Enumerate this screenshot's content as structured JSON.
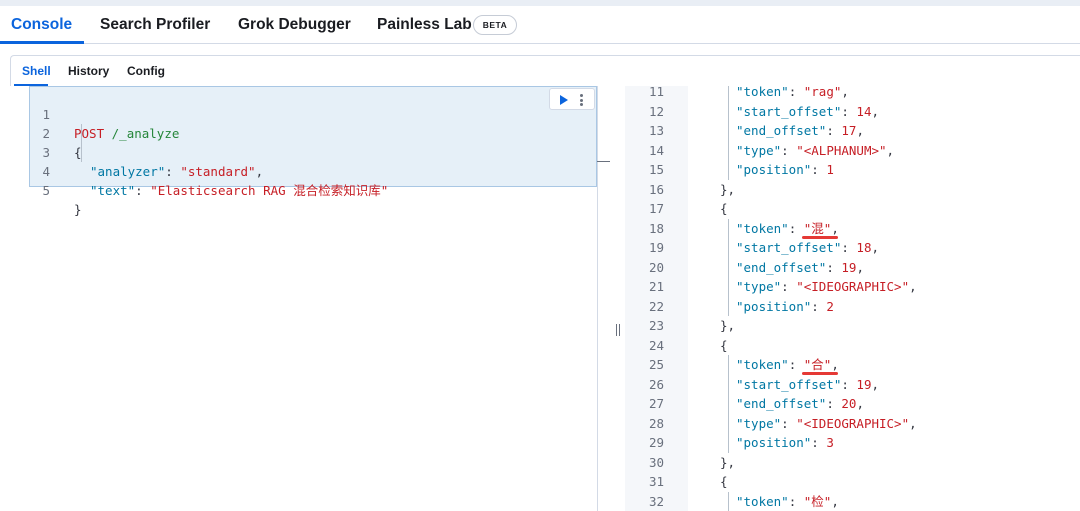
{
  "top_tabs": [
    {
      "label": "Console",
      "active": true
    },
    {
      "label": "Search Profiler",
      "active": false
    },
    {
      "label": "Grok Debugger",
      "active": false
    },
    {
      "label": "Painless Lab",
      "active": false
    }
  ],
  "beta_badge": "BETA",
  "sub_tabs": [
    {
      "label": "Shell",
      "active": true
    },
    {
      "label": "History",
      "active": false
    },
    {
      "label": "Config",
      "active": false
    }
  ],
  "request": {
    "method": "POST",
    "path": "/_analyze",
    "open_brace": "{",
    "close_brace": "}",
    "analyzer_key": "\"analyzer\"",
    "analyzer_value": "\"standard\"",
    "text_key": "\"text\"",
    "text_value": "\"Elasticsearch RAG 混合检索知识库\"",
    "line_numbers": [
      "1",
      "2",
      "3",
      "4",
      "5"
    ]
  },
  "response_lines": [
    {
      "n": "11",
      "key": "\"token\"",
      "value": "\"rag\"",
      "kind": "str"
    },
    {
      "n": "12",
      "key": "\"start_offset\"",
      "value": "14",
      "kind": "num"
    },
    {
      "n": "13",
      "key": "\"end_offset\"",
      "value": "17",
      "kind": "num"
    },
    {
      "n": "14",
      "key": "\"type\"",
      "value": "\"<ALPHANUM>\"",
      "kind": "str"
    },
    {
      "n": "15",
      "key": "\"position\"",
      "value": "1",
      "kind": "num",
      "last": true
    },
    {
      "n": "16",
      "brace": "},"
    },
    {
      "n": "17",
      "brace": "{"
    },
    {
      "n": "18",
      "key": "\"token\"",
      "value": "\"混\"",
      "kind": "str",
      "highlight": true
    },
    {
      "n": "19",
      "key": "\"start_offset\"",
      "value": "18",
      "kind": "num"
    },
    {
      "n": "20",
      "key": "\"end_offset\"",
      "value": "19",
      "kind": "num"
    },
    {
      "n": "21",
      "key": "\"type\"",
      "value": "\"<IDEOGRAPHIC>\"",
      "kind": "str"
    },
    {
      "n": "22",
      "key": "\"position\"",
      "value": "2",
      "kind": "num",
      "last": true
    },
    {
      "n": "23",
      "brace": "},"
    },
    {
      "n": "24",
      "brace": "{"
    },
    {
      "n": "25",
      "key": "\"token\"",
      "value": "\"合\"",
      "kind": "str",
      "highlight": true
    },
    {
      "n": "26",
      "key": "\"start_offset\"",
      "value": "19",
      "kind": "num"
    },
    {
      "n": "27",
      "key": "\"end_offset\"",
      "value": "20",
      "kind": "num"
    },
    {
      "n": "28",
      "key": "\"type\"",
      "value": "\"<IDEOGRAPHIC>\"",
      "kind": "str"
    },
    {
      "n": "29",
      "key": "\"position\"",
      "value": "3",
      "kind": "num",
      "last": true
    },
    {
      "n": "30",
      "brace": "},"
    },
    {
      "n": "31",
      "brace": "{"
    },
    {
      "n": "32",
      "key": "\"token\"",
      "value": "\"检\"",
      "kind": "str"
    }
  ],
  "colors": {
    "accent": "#0b64dd",
    "request_bg": "#e6f0f8",
    "string": "#c61e25",
    "key": "#0077a3",
    "highlight_mark": "#e53935"
  },
  "icons": [
    "play-icon",
    "more-vertical-icon"
  ]
}
